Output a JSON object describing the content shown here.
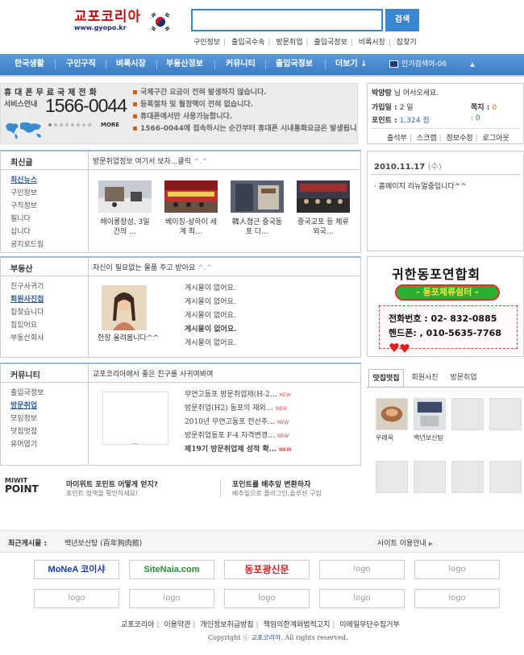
{
  "header": {
    "logo_main": "교포코리아",
    "logo_sub": "www.gyopo.kr",
    "search_button": "검색",
    "search_value": "",
    "quick_links": [
      "구인정보",
      "출입국수속",
      "방문취업",
      "출입국정보",
      "비록시장",
      "잡찾기"
    ]
  },
  "nav": {
    "items": [
      "한국생활",
      "구인구직",
      "벼룩시장",
      "부동산정보",
      "커뮤니티",
      "출입국정보",
      "더보기 ↓"
    ],
    "popular": "인기검색어-06",
    "popular_arrow": "▲"
  },
  "banner": {
    "title": "휴대폰무료국제전화",
    "subtitle": "서비스안내",
    "phone": "1566-0044",
    "more": "MORE",
    "notices": [
      "국제구간 요금이 전혀 발생하지 않습니다.",
      "등록절차 및 월정액이 전혀 없습니다.",
      "휴대폰에서만 사용가능합니다.",
      "1566-0044에 접속하시는 순간부터 휴대폰 시내통화요금은 발생됩니다."
    ]
  },
  "userbox": {
    "name": "박양랑",
    "welcome": " 님 어서오세요.",
    "stats": [
      {
        "label": "가입일",
        "value": "2 일",
        "label2": "쪽지",
        "value2": "0"
      },
      {
        "label": "포인트",
        "value": "1,324 점",
        "label2": "",
        "value2": ": 0"
      }
    ],
    "links": [
      "출석부",
      "스크랩",
      "정보수정",
      "로그아웃"
    ]
  },
  "news": {
    "heading": "최신글",
    "title": "방문취업정보 여기서 보자...클릭",
    "title_suffix": " ^.^",
    "menu": [
      "최신뉴스",
      "구인정보",
      "구직정보",
      "필니다",
      "삽니다",
      "공지로드림"
    ],
    "thumbs": [
      {
        "caption": "헤이룽장성, 3일간의 …"
      },
      {
        "caption": "베이징-상하이 세계 최…"
      },
      {
        "caption": "韓人쳠근 중국동포 다…"
      },
      {
        "caption": "중국교포 등 체류 외국…"
      }
    ]
  },
  "date_box": {
    "date": "2010.11.17",
    "weekday": "(수)",
    "message": "홈페이지 리뉴얼중입니다^^"
  },
  "realestate": {
    "heading": "부동산",
    "title": "자신이 필요없는 물품 주고 받아요",
    "title_suffix": " ^.^",
    "menu": [
      "친구사귀기",
      "회원사진첩",
      "집찾습니다",
      "집있어요",
      "부동산회사"
    ],
    "photo_caption": "한장 올려봅니다^^",
    "posts": [
      "게시물이 없어요.",
      "게시물이 없어요.",
      "게시물이 없어요.",
      "게시물이 없어요.",
      "게시물이 없어요."
    ]
  },
  "ad": {
    "org": "귀한동포연합회",
    "slogan": "- 동포체류쉼터 -",
    "phone_label": "전화번호 : 02- 832-0885",
    "mobile_label": "핸드폰: , 010-5635-7768"
  },
  "community": {
    "heading": "커뮤니티",
    "title": "교포코리아에서 좋은 친구를 사귀여봐여",
    "menu": [
      "출입국정보",
      "방문취업",
      "모임정보",
      "맛집멋집",
      "유머엽기"
    ],
    "thumb_caption": "...",
    "posts": [
      {
        "text": "무연고동포 방문취업제(H-2…",
        "new": "NEW"
      },
      {
        "text": "방문취업(H2) 동포의 재외…",
        "new": "NEW"
      },
      {
        "text": "2010년 무연고동포 전산추…",
        "new": "NEW"
      },
      {
        "text": "방문취업동포 F-4 자격변경…",
        "new": "NEW"
      },
      {
        "text": "제19기 방문취업제 성적 확…",
        "new": "NEW"
      }
    ]
  },
  "tabs": {
    "items": [
      "맛집멋집",
      "회원사진",
      "방문취업"
    ],
    "tiles": [
      {
        "caption": "우래옥"
      },
      {
        "caption": "백년보신탕"
      },
      {
        "caption": ""
      },
      {
        "caption": ""
      },
      {
        "caption": ""
      },
      {
        "caption": ""
      },
      {
        "caption": ""
      },
      {
        "caption": ""
      }
    ]
  },
  "point": {
    "label_top": "MIWIT",
    "label_bottom": "POINT",
    "q1_title": "마이위트 포인트 어떻게 얻지?",
    "q1_sub": "포인트 정책을 확인하세요!",
    "q2_title": "포인트를 배추잎 변환하자",
    "q2_sub": "배추잎으로 플러그인,솔루션 구입"
  },
  "recent": {
    "label": "최근게시물 :",
    "value": "백년보신탕 (百年狗肉館)",
    "site_info": "사이트 이용안내",
    "site_arrow": "▶"
  },
  "logos": {
    "l1": "MoNeA 코이샤",
    "l2": "SiteNaia.com",
    "l3": "동포광신문",
    "placeholder": "logo"
  },
  "footer": {
    "links": [
      "교포코리아",
      "이용약관",
      "개인정보취급방침",
      "책임의한계와법적고지",
      "이메일무단수집거부"
    ],
    "copyright_pre": "Copyright ⓒ ",
    "copyright_name": "교포코리아",
    "copyright_post": ". All rights reserved."
  },
  "colors": {
    "nav": "#3b7cc4",
    "accent": "#3b86d0"
  }
}
